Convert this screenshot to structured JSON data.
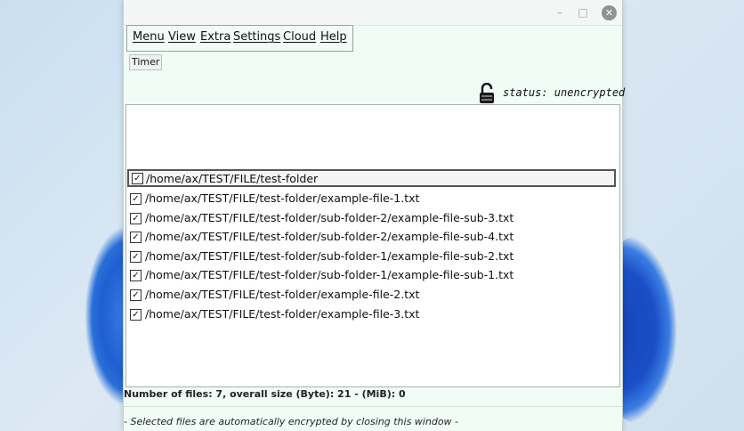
{
  "window": {
    "titlebar_buttons": {
      "minimize": "–",
      "maximize": "□",
      "close": "✕"
    }
  },
  "menubar": {
    "items": [
      {
        "label": "Menu"
      },
      {
        "label": "View"
      },
      {
        "label": "Extra"
      },
      {
        "label": "Settings"
      },
      {
        "label": "Cloud"
      },
      {
        "label": "Help"
      }
    ]
  },
  "toolbar": {
    "timer_label": "Timer"
  },
  "status": {
    "text": "status: unencrypted",
    "icon": "unlocked-padlock-icon"
  },
  "files": [
    {
      "path": "/home/ax/TEST/FILE/test-folder",
      "checked": true,
      "selected": true
    },
    {
      "path": "/home/ax/TEST/FILE/test-folder/example-file-1.txt",
      "checked": true
    },
    {
      "path": "/home/ax/TEST/FILE/test-folder/sub-folder-2/example-file-sub-3.txt",
      "checked": true
    },
    {
      "path": "/home/ax/TEST/FILE/test-folder/sub-folder-2/example-file-sub-4.txt",
      "checked": true
    },
    {
      "path": "/home/ax/TEST/FILE/test-folder/sub-folder-1/example-file-sub-2.txt",
      "checked": true
    },
    {
      "path": "/home/ax/TEST/FILE/test-folder/sub-folder-1/example-file-sub-1.txt",
      "checked": true
    },
    {
      "path": "/home/ax/TEST/FILE/test-folder/example-file-2.txt",
      "checked": true
    },
    {
      "path": "/home/ax/TEST/FILE/test-folder/example-file-3.txt",
      "checked": true
    }
  ],
  "summary": "Number of files: 7, overall size (Byte): 21 - (MiB): 0",
  "notice": "- Selected files are automatically encrypted by closing this window -",
  "check_mark": "✓"
}
